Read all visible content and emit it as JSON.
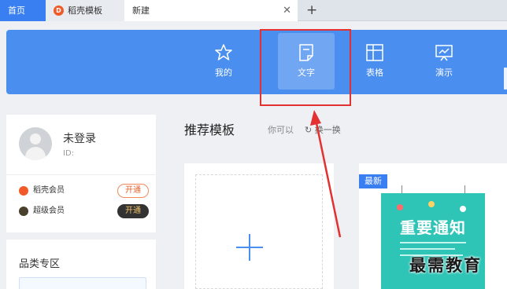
{
  "tabs": {
    "home": "首页",
    "docer": "稻壳模板",
    "new": "新建",
    "close_icon": "close-icon",
    "add_icon": "plus-icon"
  },
  "ribbon": {
    "items": [
      {
        "label": "我的",
        "icon": "star-icon"
      },
      {
        "label": "文字",
        "icon": "document-icon",
        "active": true
      },
      {
        "label": "表格",
        "icon": "table-icon"
      },
      {
        "label": "演示",
        "icon": "presentation-icon"
      }
    ],
    "color": "#4a8ef0"
  },
  "user": {
    "name": "未登录",
    "id_label": "ID:",
    "memberships": [
      {
        "label": "稻壳会员",
        "button": "开通",
        "icon_char": "D"
      },
      {
        "label": "超级会员",
        "button": "开通",
        "icon_char": "$"
      }
    ]
  },
  "category": {
    "title": "品类专区"
  },
  "recommended": {
    "title": "推荐模板",
    "subtitle": "你可以",
    "swap": "换一换",
    "new_badge": "最新",
    "poster_title": "重要通知"
  },
  "watermark": "最需教育",
  "colors": {
    "highlight": "#e33030",
    "accent": "#3a7ff1"
  }
}
